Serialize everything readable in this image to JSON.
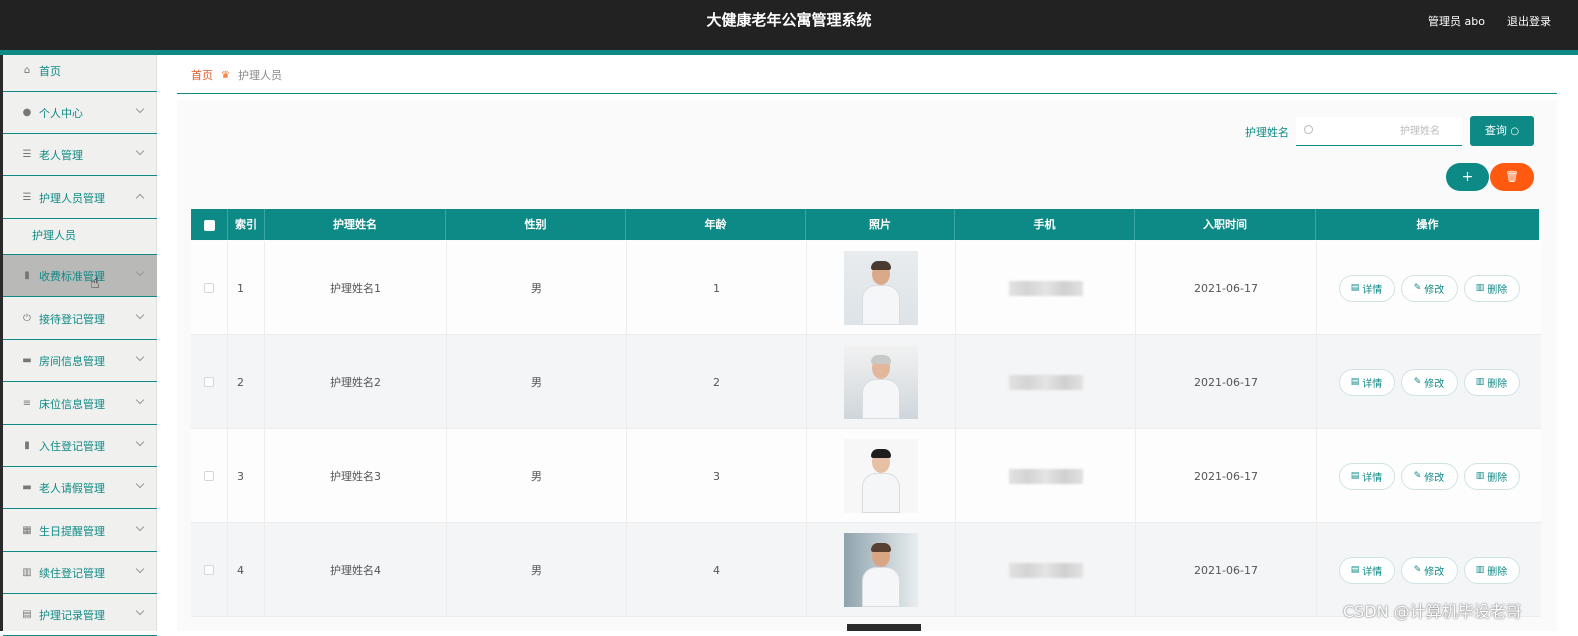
{
  "header": {
    "title": "大健康老年公寓管理系统",
    "admin": "管理员 abo",
    "logout": "退出登录"
  },
  "sidebar": {
    "items": [
      {
        "label": "首页",
        "icon": "home-icon",
        "expandable": false
      },
      {
        "label": "个人中心",
        "icon": "user-icon",
        "expandable": true
      },
      {
        "label": "老人管理",
        "icon": "list-icon",
        "expandable": true
      },
      {
        "label": "护理人员管理",
        "icon": "list-icon",
        "expandable": true,
        "expanded": true
      },
      {
        "label": "收费标准管理",
        "icon": "clipboard-icon",
        "expandable": true,
        "hovered": true
      },
      {
        "label": "接待登记管理",
        "icon": "power-icon",
        "expandable": true
      },
      {
        "label": "房间信息管理",
        "icon": "monitor-icon",
        "expandable": true
      },
      {
        "label": "床位信息管理",
        "icon": "sliders-icon",
        "expandable": true
      },
      {
        "label": "入住登记管理",
        "icon": "clipboard-icon",
        "expandable": true
      },
      {
        "label": "老人请假管理",
        "icon": "card-icon",
        "expandable": true
      },
      {
        "label": "生日提醒管理",
        "icon": "grid-icon",
        "expandable": true
      },
      {
        "label": "续住登记管理",
        "icon": "bar-chart-icon",
        "expandable": true
      },
      {
        "label": "护理记录管理",
        "icon": "document-icon",
        "expandable": true
      }
    ],
    "subitem": "护理人员"
  },
  "breadcrumb": {
    "home": "首页",
    "current": "护理人员"
  },
  "search": {
    "label": "护理姓名",
    "placeholder": "护理姓名",
    "query_button": "查询"
  },
  "toolbar": {
    "add_symbol": "+",
    "delete_icon": "trash-icon"
  },
  "table": {
    "columns": [
      "索引",
      "护理姓名",
      "性别",
      "年龄",
      "照片",
      "手机",
      "入职时间",
      "操作"
    ],
    "rows": [
      {
        "index": "1",
        "name": "护理姓名1",
        "gender": "男",
        "age": "1",
        "joined": "2021-06-17"
      },
      {
        "index": "2",
        "name": "护理姓名2",
        "gender": "男",
        "age": "2",
        "joined": "2021-06-17"
      },
      {
        "index": "3",
        "name": "护理姓名3",
        "gender": "男",
        "age": "3",
        "joined": "2021-06-17"
      },
      {
        "index": "4",
        "name": "护理姓名4",
        "gender": "男",
        "age": "4",
        "joined": "2021-06-17"
      }
    ],
    "actions": {
      "detail": "详情",
      "edit": "修改",
      "delete": "删除"
    }
  },
  "watermark": "CSDN @计算机毕设老哥",
  "colors": {
    "header_bg": "#222222",
    "accent": "#0e8a86",
    "danger": "#ff5a0f",
    "breadcrumb_home": "#e05a2a"
  }
}
